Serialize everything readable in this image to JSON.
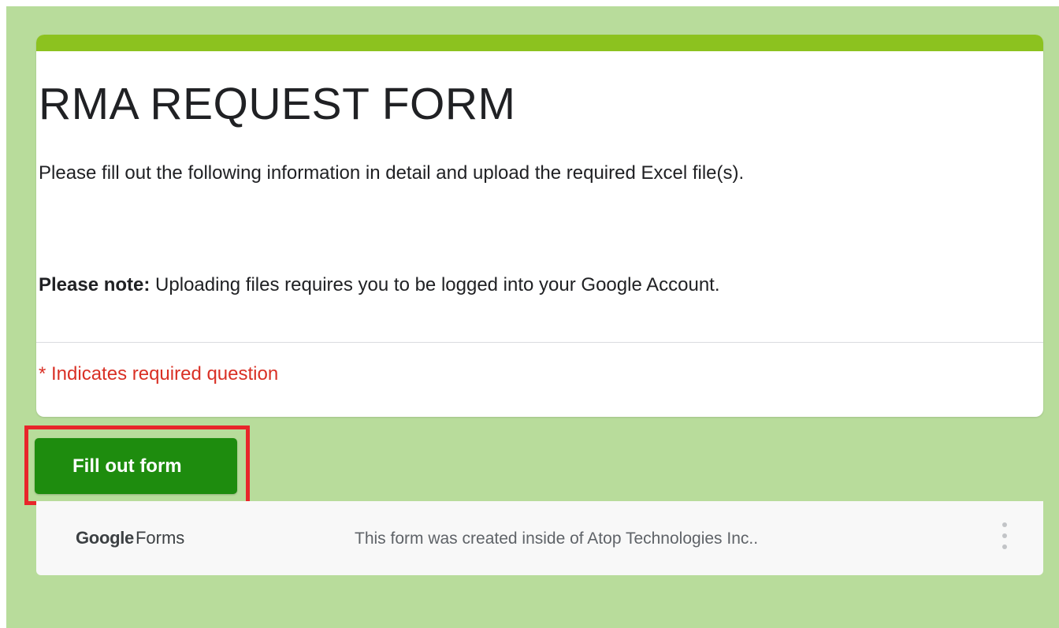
{
  "form": {
    "title": "RMA REQUEST FORM",
    "description": "Please fill out the following information in detail and upload the required Excel file(s).",
    "note_label": "Please note:",
    "note_text": " Uploading files requires you to be logged into your Google Account.",
    "required_note": "* Indicates required question"
  },
  "actions": {
    "fill_button_label": "Fill out form"
  },
  "footer": {
    "logo_brand": "Google",
    "logo_product": "Forms",
    "creator_text": "This form was created inside of Atop Technologies Inc..",
    "more_icon": "more-vertical-icon"
  },
  "colors": {
    "page_background": "#b8dc9b",
    "card_accent": "#8cc21f",
    "button": "#1e8c0e",
    "required_text": "#d93025",
    "highlight_box": "#e8262a"
  }
}
